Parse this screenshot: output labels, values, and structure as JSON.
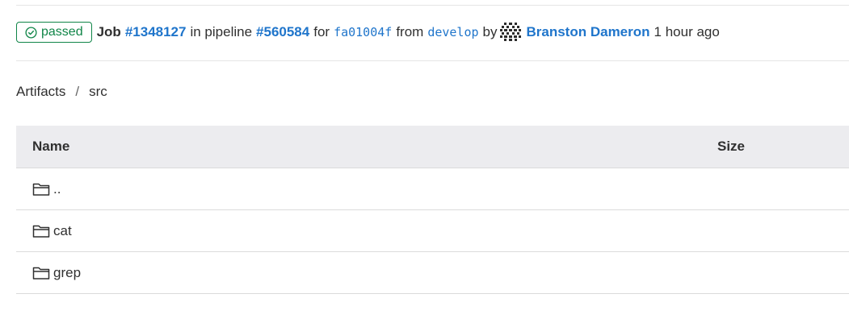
{
  "header": {
    "status": "passed",
    "job_label": "Job",
    "job_id": "#1348127",
    "in_pipeline": "in pipeline",
    "pipeline_id": "#560584",
    "for_text": "for",
    "commit": "fa01004f",
    "from_text": "from",
    "branch": "develop",
    "by_text": "by",
    "author": "Branston Dameron",
    "time": "1 hour ago"
  },
  "breadcrumb": {
    "root": "Artifacts",
    "separator": "/",
    "current": "src"
  },
  "table": {
    "columns": {
      "name": "Name",
      "size": "Size"
    },
    "rows": [
      {
        "name": "..",
        "size": ""
      },
      {
        "name": "cat",
        "size": ""
      },
      {
        "name": "grep",
        "size": ""
      }
    ]
  },
  "colors": {
    "success": "#108548",
    "link": "#1f75cb",
    "table_header_bg": "#ececef"
  }
}
